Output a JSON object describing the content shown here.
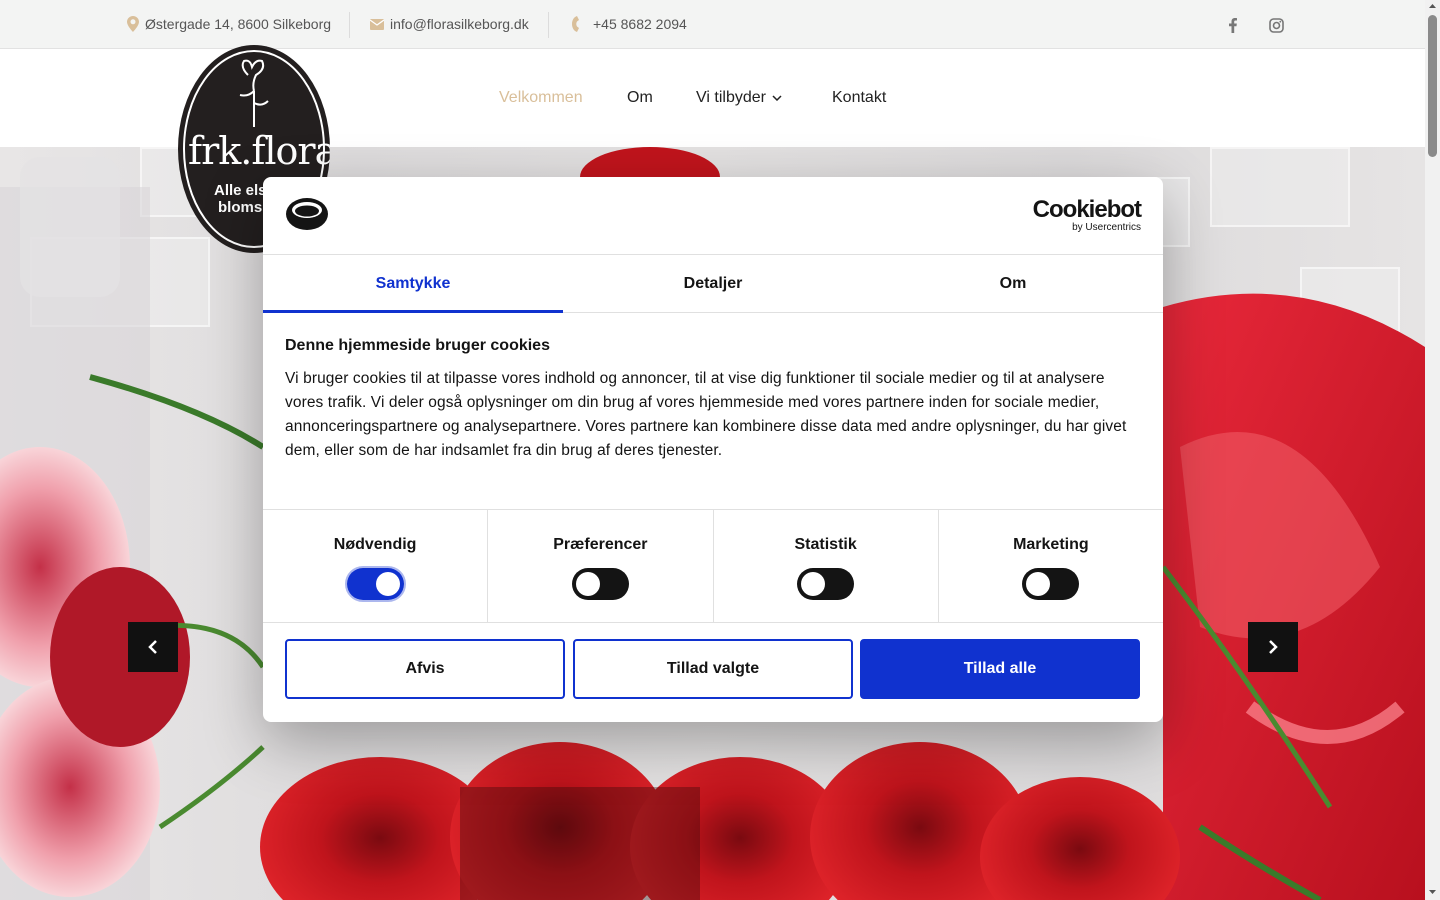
{
  "topbar": {
    "address": "Østergade 14, 8600 Silkeborg",
    "email": "info@florasilkeborg.dk",
    "phone": "+45 8682 2094",
    "icons": [
      "map-pin-icon",
      "envelope-icon",
      "phone-icon",
      "facebook-icon",
      "instagram-icon"
    ]
  },
  "logo": {
    "name": "frk.flora",
    "tagline_line1": "Alle els",
    "tagline_line2": "bloms"
  },
  "nav": {
    "items": [
      "Velkommen",
      "Om",
      "Vi tilbyder",
      "Kontakt"
    ],
    "active": "Velkommen"
  },
  "cookie_dialog": {
    "brand": "Cookiebot",
    "brand_sub": "by Usercentrics",
    "tabs": [
      "Samtykke",
      "Detaljer",
      "Om"
    ],
    "active_tab": "Samtykke",
    "title": "Denne hjemmeside bruger cookies",
    "text": "Vi bruger cookies til at tilpasse vores indhold og annoncer, til at vise dig funktioner til sociale medier og til at analysere vores trafik. Vi deler også oplysninger om din brug af vores hjemmeside med vores partnere inden for sociale medier, annonceringspartnere og analysepartnere. Vores partnere kan kombinere disse data med andre oplysninger, du har givet dem, eller som de har indsamlet fra din brug af deres tjenester.",
    "preferences": [
      {
        "label": "Nødvendig",
        "enabled": true
      },
      {
        "label": "Præferencer",
        "enabled": false
      },
      {
        "label": "Statistik",
        "enabled": false
      },
      {
        "label": "Marketing",
        "enabled": false
      }
    ],
    "buttons": {
      "reject": "Afvis",
      "allow_selected": "Tillad valgte",
      "allow_all": "Tillad alle"
    }
  },
  "colors": {
    "accent": "#1032cf",
    "nav_active": "#d9bf9a",
    "topbar_bg": "#f3f4f3",
    "rose_red": "#c0141c"
  }
}
